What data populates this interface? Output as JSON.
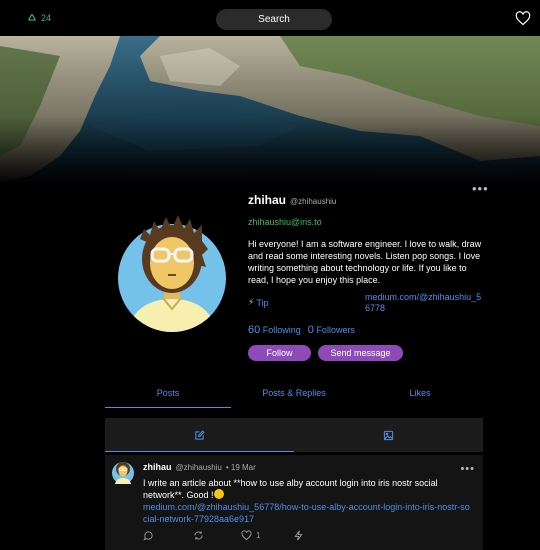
{
  "topbar": {
    "peer_count": "24",
    "search_label": "Search"
  },
  "profile": {
    "name": "zhihau",
    "handle": "@zhihaushiu",
    "nip05": "zhihaushiu@iris.to",
    "about": "Hi everyone! I am a software engineer. I love to walk, draw and read some interesting novels. Listen pop songs. I love writing something about technology or life. If you like to read, I hope you enjoy this place.",
    "tip_label": "Tip",
    "website": "medium.com/@zhihaushiu_56778",
    "following_count": "60",
    "following_label": "Following",
    "followers_count": "0",
    "followers_label": "Followers",
    "follow_button": "Follow",
    "message_button": "Send message"
  },
  "tabs": [
    {
      "label": "Posts",
      "active": true
    },
    {
      "label": "Posts & Replies",
      "active": false
    },
    {
      "label": "Likes",
      "active": false
    }
  ],
  "post": {
    "author_name": "zhihau",
    "author_handle": "@zhihaushiu",
    "time": "• 19 Mar",
    "text": "I write an article about **how to use alby account login into iris nostr social network**. Good !",
    "link": "medium.com/@zhihaushiu_56778/how-to-use-alby-account-login-into-iris-nostr-social-network-77928aa6e917",
    "like_count": "1"
  },
  "colors": {
    "accent_blue": "#4d90e6",
    "accent_green": "#3cb86b",
    "button_purple": "#8e4bb8"
  }
}
